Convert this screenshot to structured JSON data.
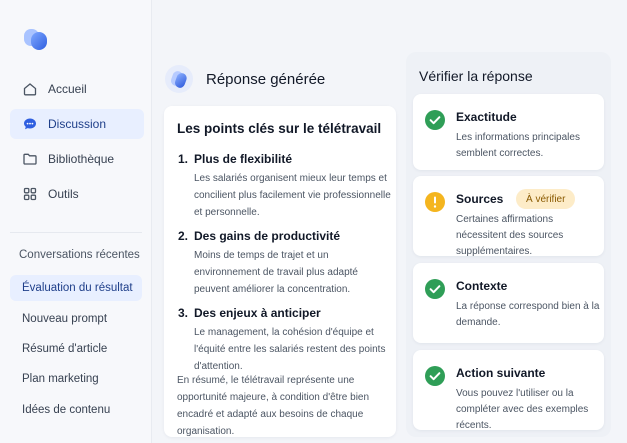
{
  "colors": {
    "accent": "#3b6ef5",
    "success": "#2f9e57",
    "warning": "#f4b51f",
    "active_bg": "#e8efff"
  },
  "sidebar": {
    "logo_icon": "brand-logo-icon",
    "nav": [
      {
        "label": "Accueil",
        "icon": "home-icon",
        "active": false
      },
      {
        "label": "Discussion",
        "icon": "chat-bubble-icon",
        "active": true
      },
      {
        "label": "Bibliothèque",
        "icon": "folder-icon",
        "active": false
      },
      {
        "label": "Outils",
        "icon": "grid-icon",
        "active": false
      }
    ],
    "section_label": "Conversations récentes",
    "conversations": [
      {
        "label": "Évaluation du résultat",
        "active": true
      },
      {
        "label": "Nouveau prompt",
        "active": false
      },
      {
        "label": "Résumé d'article",
        "active": false
      },
      {
        "label": "Plan marketing",
        "active": false
      },
      {
        "label": "Idées de contenu",
        "active": false
      }
    ]
  },
  "response": {
    "header_title": "Réponse générée",
    "heading": "Les points clés sur le télétravail",
    "points": [
      {
        "num": "1.",
        "title": "Plus de flexibilité",
        "body": "Les salariés organisent mieux leur temps et concilient plus facilement vie professionnelle et personnelle."
      },
      {
        "num": "2.",
        "title": "Des gains de productivité",
        "body": "Moins de temps de trajet et un environnement de travail plus adapté peuvent améliorer la concentration."
      },
      {
        "num": "3.",
        "title": "Des enjeux à anticiper",
        "body": "Le management, la cohésion d'équipe et l'équité entre les salariés restent des points d'attention."
      }
    ],
    "summary": "En résumé, le télétravail représente une opportunité majeure, à condition d'être bien encadré et adapté aux besoins de chaque organisation."
  },
  "verify": {
    "title": "Vérifier la réponse",
    "items": [
      {
        "title": "Exactitude",
        "status": "ok",
        "icon": "check-circle-icon",
        "desc": "Les informations principales semblent correctes."
      },
      {
        "title": "Sources",
        "status": "warning",
        "icon": "warning-circle-icon",
        "badge": "À vérifier",
        "desc": "Certaines affirmations nécessitent des sources supplémentaires."
      },
      {
        "title": "Contexte",
        "status": "ok",
        "icon": "check-circle-icon",
        "desc": "La réponse correspond bien à la demande."
      },
      {
        "title": "Action suivante",
        "status": "ok",
        "icon": "check-circle-icon",
        "desc": "Vous pouvez l'utiliser ou la compléter avec des exemples récents."
      }
    ]
  }
}
